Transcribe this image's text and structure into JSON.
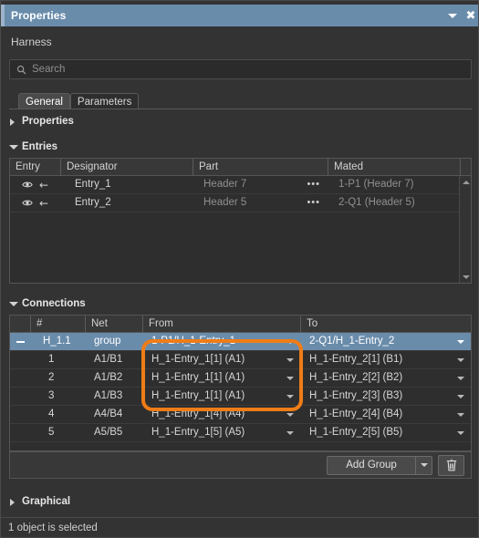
{
  "window": {
    "title": "Properties",
    "dropdown_icon": "chevron-down-icon",
    "close_icon": "close-icon",
    "subtitle": "Harness"
  },
  "search": {
    "placeholder": "Search",
    "icon": "search-icon"
  },
  "tabs": [
    {
      "label": "General",
      "active": true
    },
    {
      "label": "Parameters",
      "active": false
    }
  ],
  "sections": {
    "properties": {
      "label": "Properties",
      "expanded": false
    },
    "entries": {
      "label": "Entries",
      "expanded": true
    },
    "connections": {
      "label": "Connections",
      "expanded": true
    },
    "graphical": {
      "label": "Graphical",
      "expanded": false
    }
  },
  "entries_table": {
    "columns": [
      "Entry",
      "Designator",
      "Part",
      "Mated",
      ""
    ],
    "rows": [
      {
        "visible_icon": "eye-icon",
        "direction_icon": "arrow-left-icon",
        "designator": "Entry_1",
        "part": "Header 7",
        "more": "•••",
        "mated": "1-P1 (Header 7)"
      },
      {
        "visible_icon": "eye-icon",
        "direction_icon": "arrow-left-icon",
        "designator": "Entry_2",
        "part": "Header 5",
        "more": "•••",
        "mated": "2-Q1 (Header 5)"
      }
    ]
  },
  "connections_table": {
    "columns": [
      "",
      "#",
      "Net",
      "From",
      "To"
    ],
    "group_row": {
      "expander": "minus-icon",
      "number": "H_1.1",
      "net": "group",
      "from": "1-P1/H_1-Entry_1",
      "to": "2-Q1/H_1-Entry_2",
      "selected": true
    },
    "rows": [
      {
        "number": "1",
        "net": "A1/B1",
        "from": "H_1-Entry_1[1] (A1)",
        "to": "H_1-Entry_2[1] (B1)"
      },
      {
        "number": "2",
        "net": "A1/B2",
        "from": "H_1-Entry_1[1] (A1)",
        "to": "H_1-Entry_2[2] (B2)"
      },
      {
        "number": "3",
        "net": "A1/B3",
        "from": "H_1-Entry_1[1] (A1)",
        "to": "H_1-Entry_2[3] (B3)"
      },
      {
        "number": "4",
        "net": "A4/B4",
        "from": "H_1-Entry_1[4] (A4)",
        "to": "H_1-Entry_2[4] (B4)"
      },
      {
        "number": "5",
        "net": "A5/B5",
        "from": "H_1-Entry_1[5] (A5)",
        "to": "H_1-Entry_2[5] (B5)"
      }
    ],
    "footer": {
      "add_group_label": "Add Group",
      "add_group_dropdown_icon": "chevron-down-icon",
      "delete_icon": "trash-icon"
    }
  },
  "status": {
    "text": "1 object is selected"
  },
  "annotation": {
    "highlight_color": "#f07c17",
    "shape": "rounded-rectangle"
  },
  "colors": {
    "accent": "#6a8cab",
    "panel_bg": "#333333",
    "table_bg": "#2e2e2e",
    "header_bg": "#383838",
    "highlight": "#f07c17"
  }
}
